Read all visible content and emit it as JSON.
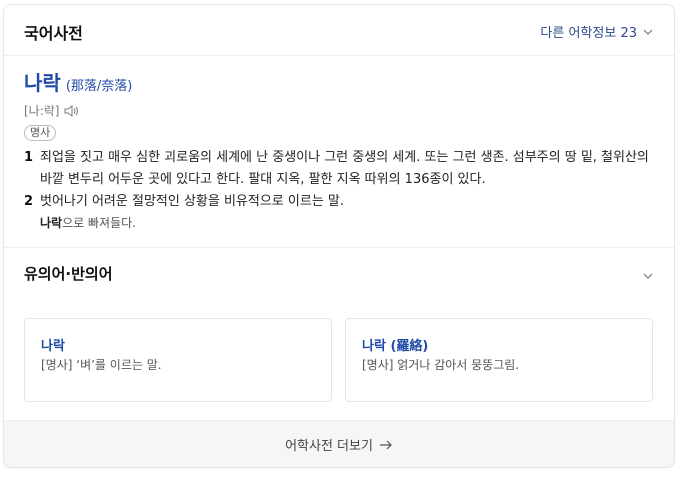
{
  "header": {
    "title": "국어사전",
    "more_label": "다른 어학정보 23"
  },
  "entry": {
    "word": "나락",
    "hanja": "(那落/奈落)",
    "pronunciation": "[나:락]",
    "pos": "명사",
    "definitions": [
      {
        "num": "1",
        "text": "죄업을 짓고 매우 심한 괴로움의 세계에 난 중생이나 그런 중생의 세계. 또는 그런 생존. 섬부주의 땅 밑, 철위산의 바깥 변두리 어두운 곳에 있다고 한다. 팔대 지옥, 팔한 지옥 따위의 136종이 있다."
      },
      {
        "num": "2",
        "text": "벗어나기 어려운 절망적인 상황을 비유적으로 이르는 말.",
        "example_word": "나락",
        "example_rest": "으로 빠져들다."
      }
    ]
  },
  "synonyms": {
    "title": "유의어·반의어",
    "items": [
      {
        "word": "나락",
        "desc": "[명사] ‘벼’를 이르는 말."
      },
      {
        "word": "나락 (羅絡)",
        "desc": "[명사] 얽거나 감아서 뭉뚱그림."
      }
    ]
  },
  "footer": {
    "label": "어학사전 더보기"
  },
  "icons": {
    "speaker": "speaker-icon",
    "chevron": "chevron-down-icon",
    "arrow": "arrow-right-icon"
  }
}
